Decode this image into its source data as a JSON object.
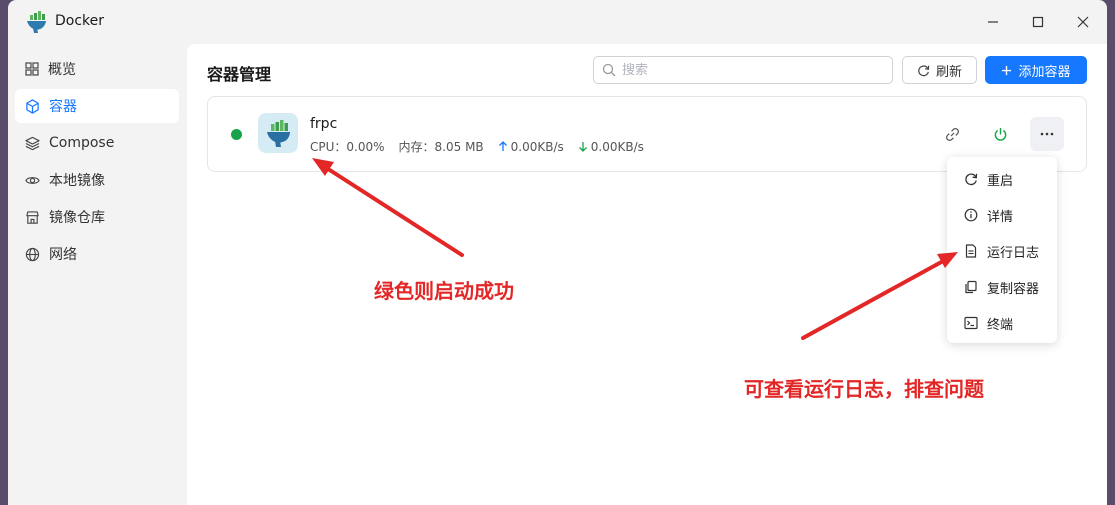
{
  "window": {
    "title": "Docker"
  },
  "sidebar": {
    "items": [
      {
        "label": "概览",
        "icon": "grid-icon"
      },
      {
        "label": "容器",
        "icon": "cube-icon",
        "active": true
      },
      {
        "label": "Compose",
        "icon": "layers-icon"
      },
      {
        "label": "本地镜像",
        "icon": "eye-icon"
      },
      {
        "label": "镜像仓库",
        "icon": "store-icon"
      },
      {
        "label": "网络",
        "icon": "globe-icon"
      }
    ]
  },
  "main": {
    "title": "容器管理",
    "search_placeholder": "搜索",
    "refresh_label": "刷新",
    "add_label": "添加容器"
  },
  "containers": [
    {
      "name": "frpc",
      "status": "running",
      "status_color": "#16a34a",
      "cpu_label": "CPU：0.00%",
      "mem_label": "内存：8.05 MB",
      "upload": "0.00KB/s",
      "download": "0.00KB/s"
    }
  ],
  "menu": {
    "items": [
      {
        "label": "重启",
        "icon": "restart-icon"
      },
      {
        "label": "详情",
        "icon": "info-icon"
      },
      {
        "label": "运行日志",
        "icon": "log-icon"
      },
      {
        "label": "复制容器",
        "icon": "copy-icon"
      },
      {
        "label": "终端",
        "icon": "terminal-icon"
      }
    ]
  },
  "annotations": {
    "green_status": "绿色则启动成功",
    "logs_hint": "可查看运行日志，排查问题"
  },
  "colors": {
    "accent": "#1677ff",
    "annotation": "#e32626",
    "running": "#16a34a"
  }
}
